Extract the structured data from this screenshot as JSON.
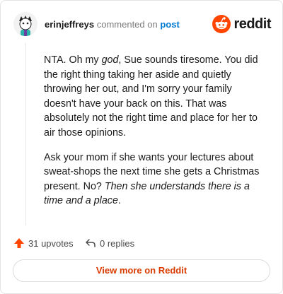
{
  "comment": {
    "username": "erinjeffreys",
    "action_text": "commented on",
    "post_link_text": "post",
    "brand": "reddit",
    "paragraph_1": "NTA. Oh my god, Sue sounds tiresome. You did the right thing taking her aside and quietly throwing her out, and I'm sorry your family doesn't have your back on this. That was absolutely not the right time and place for her to air those opinions.",
    "paragraph_1_parts": {
      "before": "NTA. Oh my ",
      "emphasis": "god",
      "after": ", Sue sounds tiresome. You did the right thing taking her aside and quietly throwing her out, and I'm sorry your family doesn't have your back on this. That was absolutely not the right time and place for her to air those opinions."
    },
    "paragraph_2_parts": {
      "before": "Ask your mom if she wants your lectures about sweat-shops the next time she gets a Christmas present. No? ",
      "emphasis": "Then she understands there is a time and a place",
      "after": "."
    }
  },
  "footer": {
    "upvotes_label": "31 upvotes",
    "replies_label": "0 replies",
    "view_more_label": "View more on Reddit"
  },
  "icons": {
    "avatar": "avatar-image",
    "brand_logo": "reddit-alien-icon",
    "upvote": "upvote-arrow-icon",
    "reply": "reply-arrow-icon"
  },
  "colors": {
    "brand_orange": "#ff4500",
    "link_blue": "#0079d3",
    "view_more_text": "#d93a00",
    "upvote_arrow": "#ff4500"
  }
}
